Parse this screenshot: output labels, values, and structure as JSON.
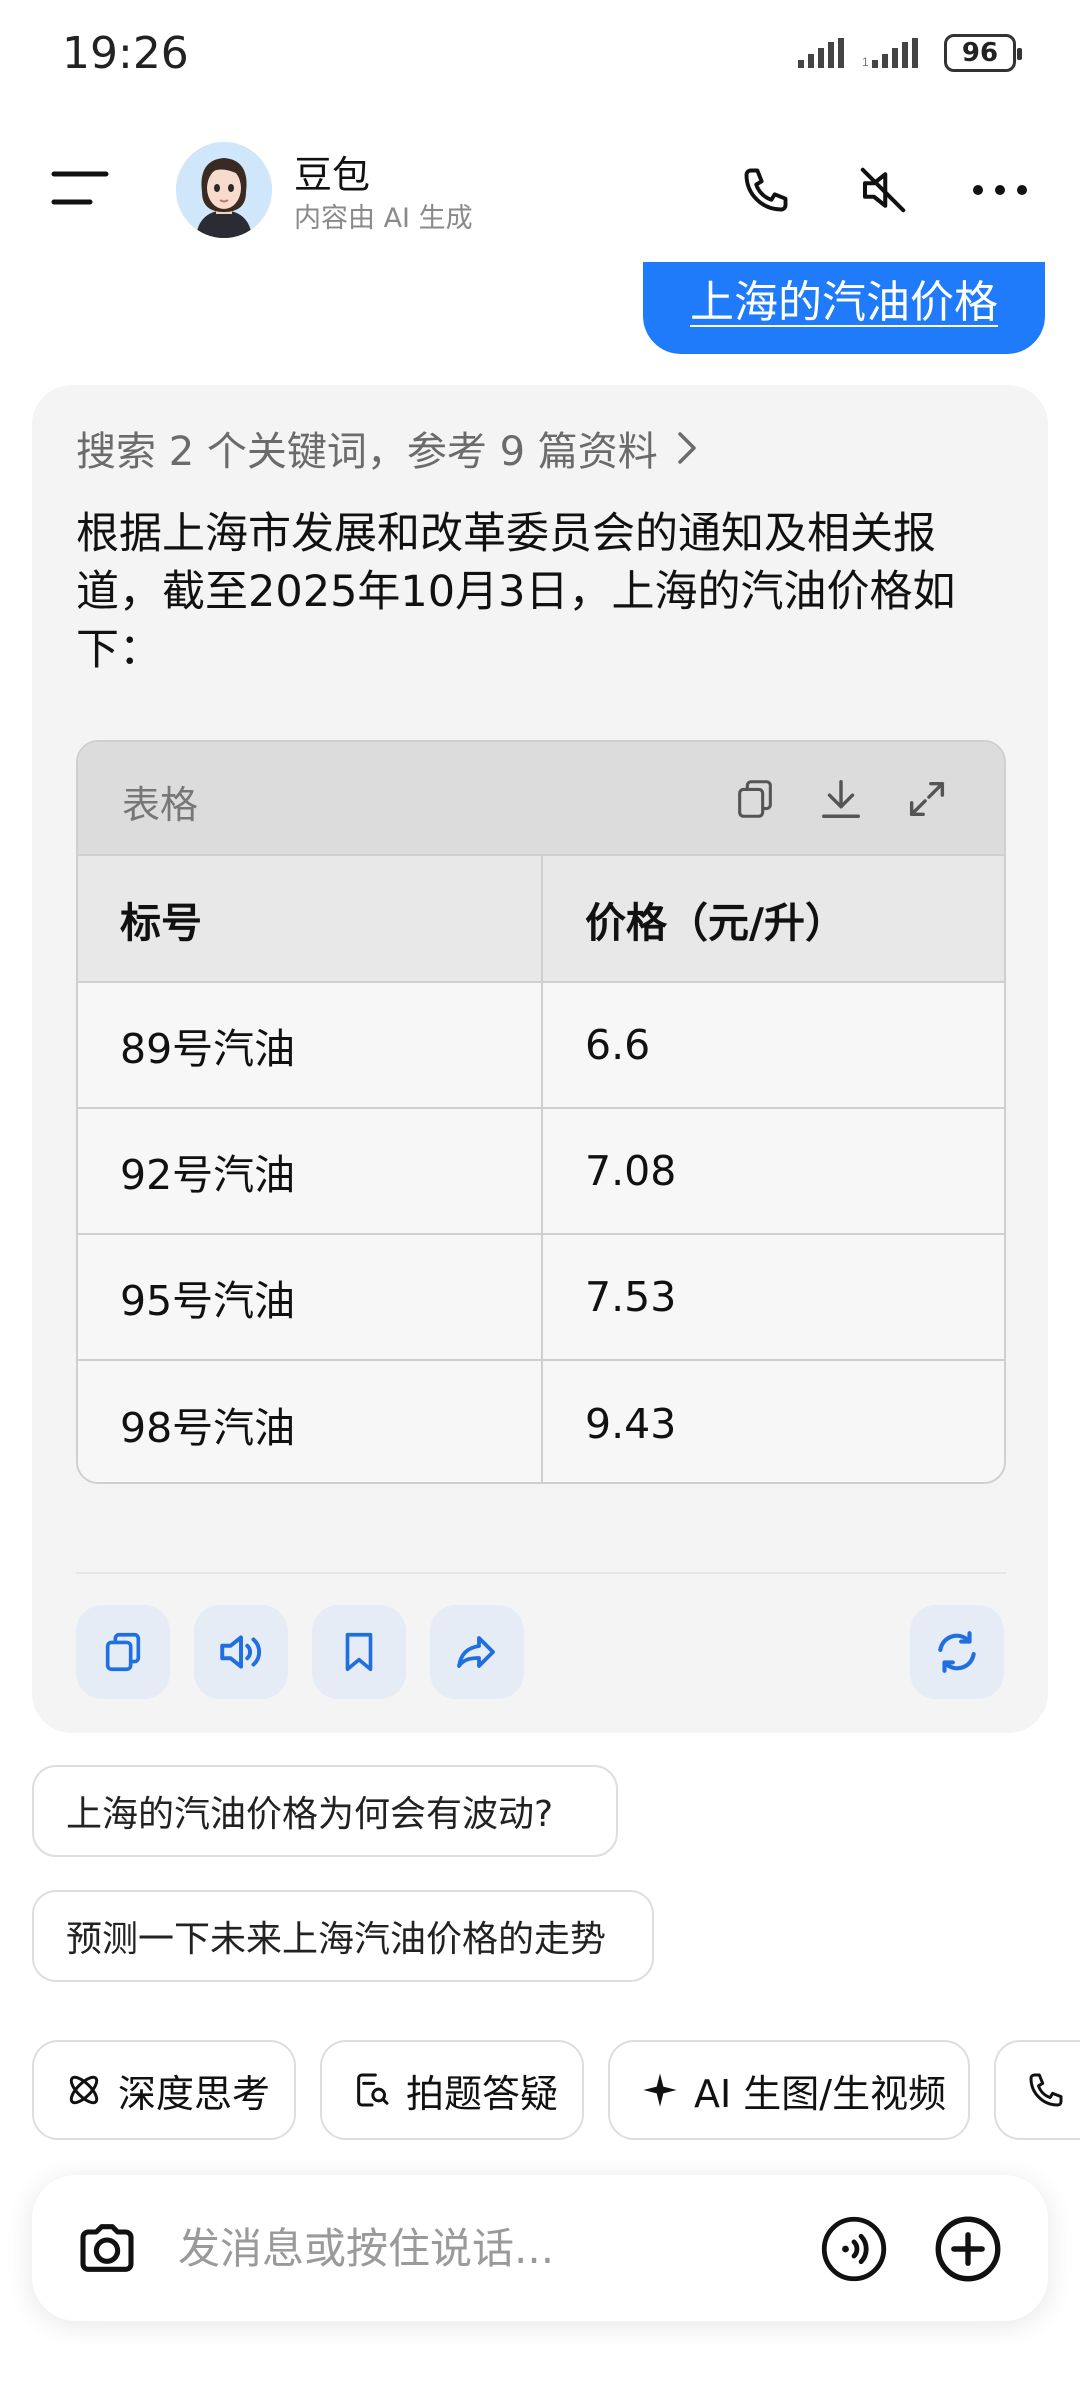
{
  "status_bar": {
    "time": "19:26",
    "battery": "96"
  },
  "header": {
    "bot_name": "豆包",
    "subtitle": "内容由 AI 生成"
  },
  "user_message": "上海的汽油价格",
  "answer": {
    "search_ref": "搜索 2 个关键词，参考 9 篇资料",
    "intro_text": "根据上海市发展和改革委员会的通知及相关报道，截至2025年10月3日，上海的汽油价格如下：",
    "table": {
      "title": "表格",
      "headers": [
        "标号",
        "价格（元/升）"
      ],
      "rows": [
        [
          "89号汽油",
          "6.6"
        ],
        [
          "92号汽油",
          "7.08"
        ],
        [
          "95号汽油",
          "7.53"
        ],
        [
          "98号汽油",
          "9.43"
        ]
      ]
    }
  },
  "suggestions": [
    "上海的汽油价格为何会有波动?",
    "预测一下未来上海汽油价格的走势"
  ],
  "chips": [
    {
      "label": "深度思考",
      "icon": "atom-icon"
    },
    {
      "label": "拍题答疑",
      "icon": "photo-search-icon"
    },
    {
      "label": "AI 生图/生视频",
      "icon": "sparkle-icon"
    },
    {
      "label": "",
      "icon": "phone-icon"
    }
  ],
  "input": {
    "placeholder": "发消息或按住说话..."
  },
  "colors": {
    "accent": "#1f7bfa",
    "icon_blue": "#1f6fe0",
    "card_bg": "#f4f4f5"
  }
}
